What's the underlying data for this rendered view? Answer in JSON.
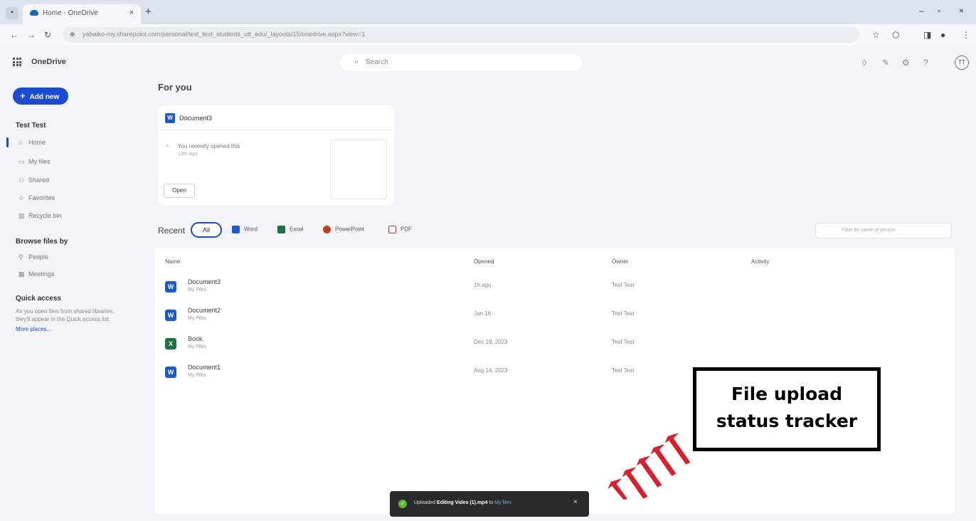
{
  "browser": {
    "tab_square": "▪",
    "tab_title": "Home - OneDrive",
    "tab_close": "×",
    "tab_new": "+",
    "win_min": "–",
    "win_max": "▫",
    "win_close": "×",
    "nav_back": "←",
    "nav_fwd": "→",
    "nav_reload": "↻",
    "url_lock": "⊕",
    "url": "yabaiko-my.sharepoint.com/personal/test_test_students_utt_edu/_layouts/15/onedrive.aspx?view=1",
    "icon_star": "☆",
    "icon_ext": "⬡",
    "icon_side": "◨",
    "icon_profile": "●",
    "icon_menu": "⋮"
  },
  "app": {
    "name": "OneDrive",
    "search_icon": "⌕",
    "search_placeholder": "Search",
    "icon_share": "◊",
    "icon_brush": "✎",
    "icon_settings": "⚙",
    "icon_help": "?",
    "avatar_initials": "TT"
  },
  "sidebar": {
    "add_plus": "+",
    "add_new": "Add new",
    "user_name": "Test Test",
    "items": [
      {
        "icon": "⌂",
        "label": "Home"
      },
      {
        "icon": "▭",
        "label": "My files"
      },
      {
        "icon": "⚇",
        "label": "Shared"
      },
      {
        "icon": "☆",
        "label": "Favorites"
      },
      {
        "icon": "▥",
        "label": "Recycle bin"
      }
    ],
    "browse_heading": "Browse files by",
    "browse_items": [
      {
        "icon": "⚲",
        "label": "People"
      },
      {
        "icon": "▦",
        "label": "Meetings"
      }
    ],
    "quick_access_heading": "Quick access",
    "quick_access_text": "As you open files from shared libraries, they'll appear in the Quick access list.",
    "more_places": "More places..."
  },
  "for_you": {
    "heading": "For you",
    "card": {
      "doc_letter": "W",
      "title": "Document3",
      "clock": "◔",
      "reason": "You recently opened this",
      "time": "13m ago",
      "open_label": "Open"
    }
  },
  "recent": {
    "heading": "Recent",
    "filters": {
      "all": "All",
      "word": "Word",
      "excel": "Excel",
      "powerpoint": "PowerPoint",
      "pdf": "PDF"
    },
    "filter_placeholder": "Filter by name or person",
    "columns": {
      "name": "Name",
      "opened": "Opened",
      "owner": "Owner",
      "activity": "Activity"
    },
    "rows": [
      {
        "type": "word",
        "letter": "W",
        "name": "Document3",
        "location": "My Files",
        "opened": "1h ago",
        "owner": "Test Test"
      },
      {
        "type": "word",
        "letter": "W",
        "name": "Document2",
        "location": "My Files",
        "opened": "Jan 16",
        "owner": "Test Test"
      },
      {
        "type": "excel",
        "letter": "X",
        "name": "Book",
        "location": "My Files",
        "opened": "Dec 19, 2023",
        "owner": "Test Test"
      },
      {
        "type": "word",
        "letter": "W",
        "name": "Document1",
        "location": "My Files",
        "opened": "Aug 14, 2023",
        "owner": "Test Test"
      }
    ]
  },
  "toast": {
    "check": "✓",
    "prefix": "Uploaded",
    "filename": "Editing Video (1).mp4",
    "to": "to",
    "destination": "My files",
    "close": "×"
  },
  "annotation": {
    "line1": "File upload",
    "line2": "status tracker"
  },
  "colors": {
    "accent": "#1b4bd0",
    "word": "#1a5bc9",
    "excel": "#1e7145",
    "powerpoint": "#c43e1c",
    "pdf": "#d13438",
    "toast_bg": "#2a2a2a",
    "success": "#5fb832",
    "arrow_red": "#d9202e"
  }
}
